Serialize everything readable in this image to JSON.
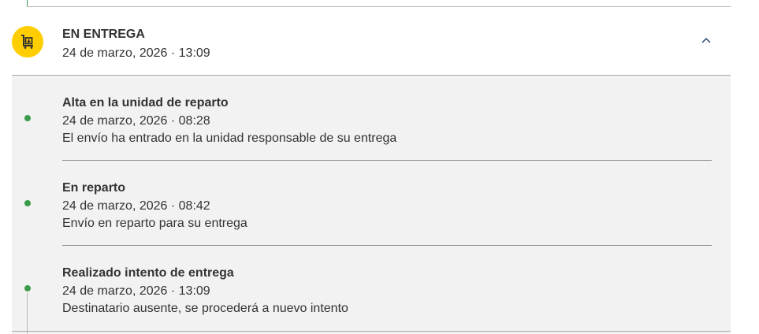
{
  "group": {
    "title": "EN ENTREGA",
    "date": "24 de marzo, 2026 · 13:09",
    "status_icon": "delivery-cart-icon",
    "toggle_icon": "chevron-up-icon",
    "accent_color": "#ffcd00",
    "timeline_color": "#3a9c4b"
  },
  "events": [
    {
      "title": "Alta en la unidad de reparto",
      "date": "24 de marzo, 2026 · 08:28",
      "description": "El envío ha entrado en la unidad responsable de su entrega"
    },
    {
      "title": "En reparto",
      "date": "24 de marzo, 2026 · 08:42",
      "description": "Envío en reparto para su entrega"
    },
    {
      "title": "Realizado intento de entrega",
      "date": "24 de marzo, 2026 · 13:09",
      "description": "Destinatario ausente, se procederá a nuevo intento"
    }
  ]
}
